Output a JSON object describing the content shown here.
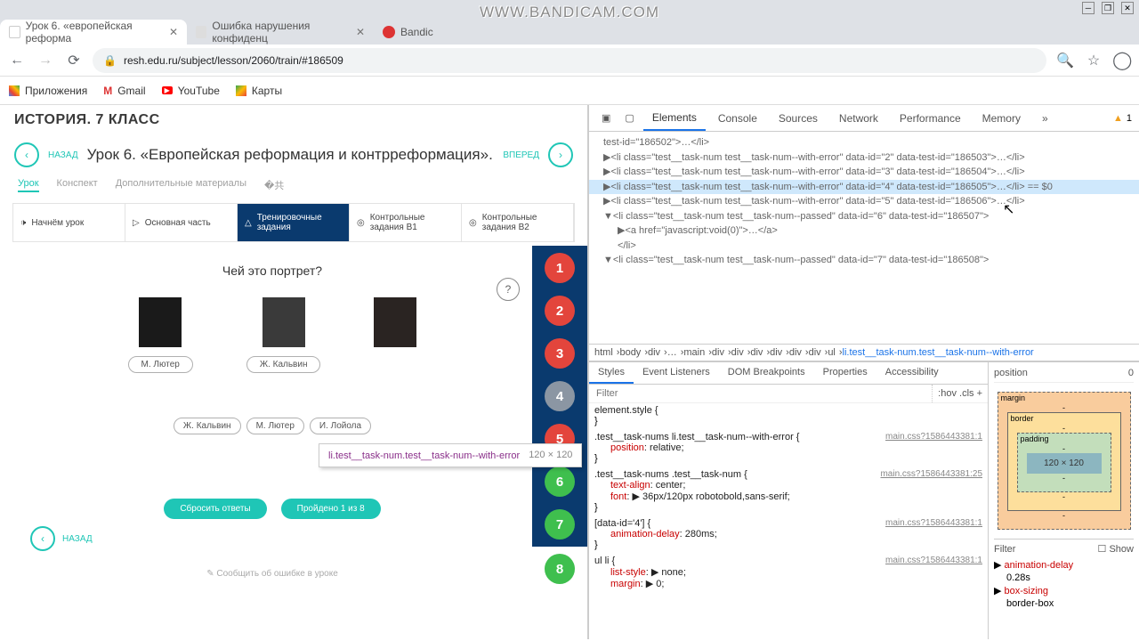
{
  "watermark": "WWW.BANDICAM.COM",
  "window": {
    "min": "─",
    "max": "❐",
    "close": "✕"
  },
  "tabs": [
    {
      "title": "Урок 6. «европейская реформа",
      "favicon_bg": "#fff"
    },
    {
      "title": "Ошибка нарушения конфиденц",
      "favicon_bg": "#ddd"
    },
    {
      "title": "Bandic",
      "favicon_bg": "#d33"
    }
  ],
  "addr": {
    "back": "←",
    "fwd": "→",
    "reload": "⟳",
    "lock": "🔒",
    "url": "resh.edu.ru/subject/lesson/2060/train/#186509",
    "search": "🔍",
    "star": "☆",
    "user": "◯"
  },
  "bookmarks": {
    "apps": "Приложения",
    "gmail": "Gmail",
    "youtube": "YouTube",
    "maps": "Карты"
  },
  "page": {
    "subject": "ИСТОРИЯ. 7 КЛАСС",
    "back": "НАЗАД",
    "lesson_title": "Урок 6. «Европейская реформация и контрреформация».",
    "fwd": "ВПЕРЕД",
    "subnav": {
      "urok": "Урок",
      "konspekt": "Конспект",
      "dop": "Дополнительные материалы"
    },
    "stages": {
      "s1": "Начнём урок",
      "s2": "Основная часть",
      "s3a": "Тренировочные",
      "s3b": "задания",
      "s4a": "Контрольные",
      "s4b": "задания B1",
      "s5a": "Контрольные",
      "s5b": "задания B2"
    },
    "question": "Чей это портрет?",
    "help": "?",
    "names": {
      "n1": "М. Лютер",
      "n2": "Ж. Кальвин"
    },
    "chips": {
      "c1": "Ж. Кальвин",
      "c2": "М. Лютер",
      "c3": "И. Лойола"
    },
    "actions": {
      "reset": "Сбросить ответы",
      "progress": "Пройдено 1 из 8"
    },
    "report": "Сообщить об ошибке в уроке",
    "back2": "НАЗАД",
    "nums": {
      "n1": "1",
      "n2": "2",
      "n3": "3",
      "n4": "4",
      "n5": "5",
      "n6": "6",
      "n7": "7",
      "n8": "8"
    }
  },
  "tooltip": {
    "cls": "li.test__task-num.test__task-num--with-error",
    "dim": "120 × 120"
  },
  "dt": {
    "tabs": {
      "elements": "Elements",
      "console": "Console",
      "sources": "Sources",
      "network": "Network",
      "performance": "Performance",
      "memory": "Memory",
      "more": "»"
    },
    "warn_count": "1",
    "dom_lines": [
      "test-id=\"186502\">…</li>",
      "▶<li class=\"test__task-num test__task-num--with-error\" data-id=\"2\" data-test-id=\"186503\">…</li>",
      "▶<li class=\"test__task-num test__task-num--with-error\" data-id=\"3\" data-test-id=\"186504\">…</li>",
      "▶<li class=\"test__task-num test__task-num--with-error\" data-id=\"4\" data-test-id=\"186505\">…</li> == $0",
      "▶<li class=\"test__task-num test__task-num--with-error\" data-id=\"5\" data-test-id=\"186506\">…</li>",
      "▼<li class=\"test__task-num test__task-num--passed\" data-id=\"6\" data-test-id=\"186507\">",
      "  ▶<a href=\"javascript:void(0)\">…</a>",
      "  </li>",
      "▼<li class=\"test__task-num test__task-num--passed\" data-id=\"7\" data-test-id=\"186508\">"
    ],
    "crumbs": {
      "items": [
        "html",
        "body",
        "div",
        "…",
        "main",
        "div",
        "div",
        "div",
        "div",
        "div",
        "div",
        "ul"
      ],
      "sel": "li.test__task-num.test__task-num--with-error"
    },
    "styles_tabs": {
      "styles": "Styles",
      "ev": "Event Listeners",
      "bp": "DOM Breakpoints",
      "prop": "Properties",
      "acc": "Accessibility"
    },
    "filter_ph": "Filter",
    "filter_opts": ":hov  .cls  +",
    "rules": {
      "r0": "element.style {",
      "r1_sel": ".test__task-nums li.test__task-num--with-error {",
      "r1_src": "main.css?1586443381:1",
      "r1_p1n": "position",
      "r1_p1v": ": relative;",
      "r2_sel": ".test__task-nums .test__task-num {",
      "r2_src": "main.css?1586443381:25",
      "r2_p1n": "text-align",
      "r2_p1v": ": center;",
      "r2_p2n": "font",
      "r2_p2v": ": ▶ 36px/120px robotobold,sans-serif;",
      "r3_sel": "[data-id='4'] {",
      "r3_src": "main.css?1586443381:1",
      "r3_p1n": "animation-delay",
      "r3_p1v": ": 280ms;",
      "r4_sel": "ul li {",
      "r4_src": "main.css?1586443381:1",
      "r4_p1n": "list-style",
      "r4_p1v": ": ▶ none;",
      "r4_p2n": "margin",
      "r4_p2v": ": ▶ 0;",
      "brace": "}"
    },
    "box": {
      "position": "position",
      "zero": "0",
      "margin": "margin",
      "border": "border",
      "padding": "padding",
      "content": "120 × 120",
      "dash": "-"
    },
    "computed_filter": "Filter",
    "show": "Show",
    "computed": {
      "c1n": "animation-delay",
      "c1v": "0.28s",
      "c2n": "box-sizing",
      "c2v": "border-box"
    }
  }
}
